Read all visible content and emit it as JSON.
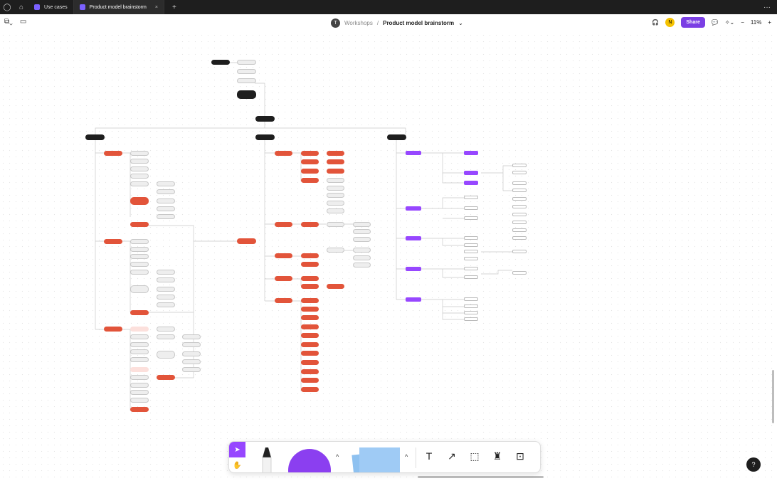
{
  "tabs": {
    "home_icon": "home-icon",
    "items": [
      {
        "label": "Use cases",
        "active": false
      },
      {
        "label": "Product model brainstorm",
        "active": true
      }
    ],
    "new_tab": "+",
    "more": "···"
  },
  "toolbar": {
    "main_menu_icon": "figjam-menu-icon",
    "layout_icon": "sidebar-icon",
    "breadcrumb": {
      "avatar": "T",
      "team": "Workshops",
      "sep": "/",
      "file": "Product model brainstorm",
      "chevron": "⌄"
    },
    "user_avatar": "N",
    "share_label": "Share",
    "zoom_label": "11%",
    "zoom_minus": "−",
    "zoom_plus": "+"
  },
  "dock": {
    "caret": "^",
    "text_tool": "T",
    "connector_tool": "↗",
    "section_tool": "⬚",
    "stamp_tool": "♜",
    "widgets_tool": "⊡"
  },
  "help_label": "?",
  "colors": {
    "accent": "#9747ff",
    "share": "#7b3fe4",
    "node_red": "#e2543a",
    "node_dark": "#1e1e1e",
    "sticky": "#9fcbf5"
  }
}
